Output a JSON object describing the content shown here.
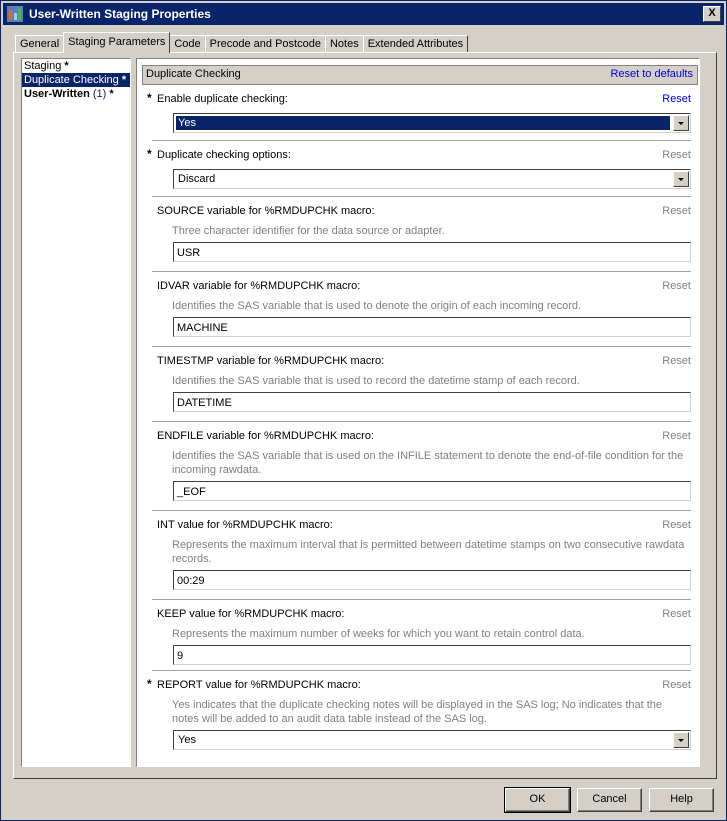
{
  "window": {
    "title": "User-Written Staging Properties",
    "close_label": "X"
  },
  "tabs": [
    {
      "label": "General"
    },
    {
      "label": "Staging Parameters",
      "active": true
    },
    {
      "label": "Code"
    },
    {
      "label": "Precode and Postcode"
    },
    {
      "label": "Notes"
    },
    {
      "label": "Extended Attributes"
    }
  ],
  "nav": {
    "items": [
      {
        "label": "Staging",
        "star": "*"
      },
      {
        "label": "Duplicate Checking",
        "star": "*",
        "selected": true
      },
      {
        "label": "User-Written",
        "count": "(1)",
        "star": "*"
      }
    ]
  },
  "section": {
    "title": "Duplicate Checking",
    "reset_all_label": "Reset to defaults"
  },
  "fields": {
    "enable": {
      "required": "*",
      "label": "Enable duplicate checking:",
      "reset": "Reset",
      "value": "Yes"
    },
    "options": {
      "required": "*",
      "label": "Duplicate checking options:",
      "reset": "Reset",
      "value": "Discard"
    },
    "source": {
      "label": "SOURCE variable for %RMDUPCHK macro:",
      "reset": "Reset",
      "description": "Three character identifier for the data source or adapter.",
      "value": "USR"
    },
    "idvar": {
      "label": "IDVAR variable for %RMDUPCHK macro:",
      "reset": "Reset",
      "description": "Identifies the SAS variable that is used to denote the origin of each incoming record.",
      "value": "MACHINE"
    },
    "timestmp": {
      "label": "TIMESTMP variable for %RMDUPCHK macro:",
      "reset": "Reset",
      "description": "Identifies the SAS variable that is used to record the datetime stamp of each record.",
      "value": "DATETIME"
    },
    "endfile": {
      "label": "ENDFILE variable for %RMDUPCHK macro:",
      "reset": "Reset",
      "description": "Identifies the SAS variable that is used on the INFILE statement to denote the end-of-file condition for the incoming rawdata.",
      "value": "_EOF"
    },
    "int": {
      "label": "INT value for %RMDUPCHK macro:",
      "reset": "Reset",
      "description": "Represents the maximum interval that is permitted between datetime stamps on two consecutive rawdata records.",
      "value": "00:29"
    },
    "keep": {
      "label": "KEEP value for %RMDUPCHK macro:",
      "reset": "Reset",
      "description": "Represents the maximum number of weeks for which you want to retain control data.",
      "value": "9"
    },
    "report": {
      "required": "*",
      "label": "REPORT value for %RMDUPCHK macro:",
      "reset": "Reset",
      "description": "Yes indicates that the duplicate checking notes will be displayed in the SAS log; No indicates that the notes will be added to an audit data table instead of the SAS log.",
      "value": "Yes"
    }
  },
  "buttons": {
    "ok": "OK",
    "cancel": "Cancel",
    "help": "Help"
  }
}
